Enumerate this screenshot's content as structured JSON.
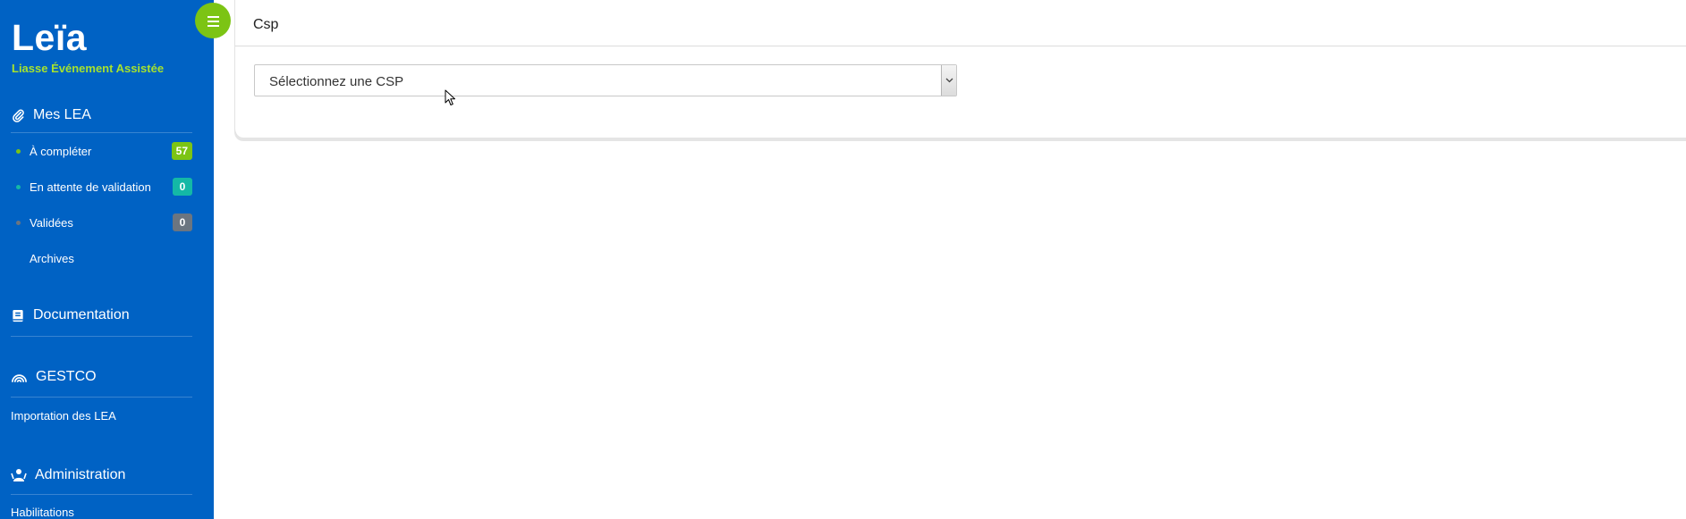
{
  "app": {
    "logo": "Leïa",
    "subtitle": "Liasse Événement Assistée"
  },
  "sidebar": {
    "mes_lea": {
      "label": "Mes LEA",
      "items": [
        {
          "label": "À compléter",
          "count": "57",
          "dot_color": "#7cc414",
          "badge_color": "#7cc414"
        },
        {
          "label": "En attente de validation",
          "count": "0",
          "dot_color": "#14b8a6",
          "badge_color": "#14b8a6"
        },
        {
          "label": "Validées",
          "count": "0",
          "dot_color": "#6b7580",
          "badge_color": "#6b7580"
        },
        {
          "label": "Archives"
        }
      ]
    },
    "documentation": {
      "label": "Documentation"
    },
    "gestco": {
      "label": "GESTCO",
      "items": [
        {
          "label": "Importation des LEA"
        }
      ]
    },
    "administration": {
      "label": "Administration",
      "items": [
        {
          "label": "Habilitations"
        }
      ]
    }
  },
  "main": {
    "panel_title": "Csp",
    "select": {
      "value": "Sélectionnez une CSP"
    }
  },
  "colors": {
    "sidebar_bg": "#0062c4",
    "accent_green": "#7cc414",
    "subtitle_green": "#a6e22e",
    "teal": "#14b8a6",
    "gray": "#6b7580"
  },
  "icons": {
    "menu_toggle": "hamburger-icon",
    "mes_lea": "paperclip-icon",
    "documentation": "book-icon",
    "gestco": "signal-waves-icon",
    "administration": "users-cog-icon",
    "select_arrow": "chevron-down-icon",
    "cursor": "mouse-pointer-icon"
  }
}
